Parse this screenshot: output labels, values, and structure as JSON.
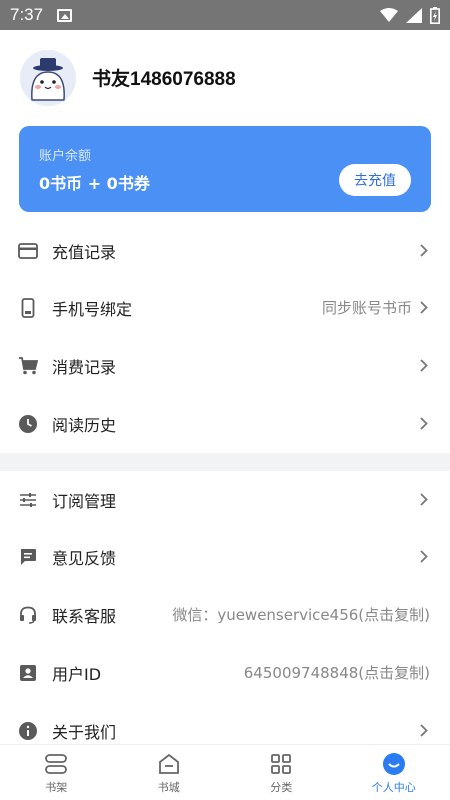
{
  "status_bar": {
    "time": "7:37"
  },
  "profile": {
    "nickname": "书友1486076888"
  },
  "balance": {
    "label": "账户余额",
    "value": "0书币 + 0书券",
    "recharge_label": "去充值"
  },
  "menu": {
    "group1": [
      {
        "label": "充值记录",
        "value": "",
        "icon": "card-icon"
      },
      {
        "label": "手机号绑定",
        "value": "同步账号书币",
        "icon": "phone-icon"
      },
      {
        "label": "消费记录",
        "value": "",
        "icon": "cart-icon"
      },
      {
        "label": "阅读历史",
        "value": "",
        "icon": "clock-icon"
      }
    ],
    "group2": [
      {
        "label": "订阅管理",
        "value": "",
        "icon": "sliders-icon"
      },
      {
        "label": "意见反馈",
        "value": "",
        "icon": "feedback-icon"
      },
      {
        "label": "联系客服",
        "value": "微信：yuewenservice456(点击复制)",
        "icon": "headset-icon"
      },
      {
        "label": "用户ID",
        "value": "645009748848(点击复制)",
        "icon": "id-card-icon"
      },
      {
        "label": "关于我们",
        "value": "",
        "icon": "info-icon"
      }
    ]
  },
  "tabs": [
    {
      "label": "书架",
      "icon": "bookshelf-icon",
      "active": false
    },
    {
      "label": "书城",
      "icon": "bookstore-icon",
      "active": false
    },
    {
      "label": "分类",
      "icon": "category-grid-icon",
      "active": false
    },
    {
      "label": "个人中心",
      "icon": "profile-face-icon",
      "active": true
    }
  ],
  "colors": {
    "accent": "#4a90f5",
    "active_tab": "#2b7bf3",
    "status_bar": "#757575"
  }
}
